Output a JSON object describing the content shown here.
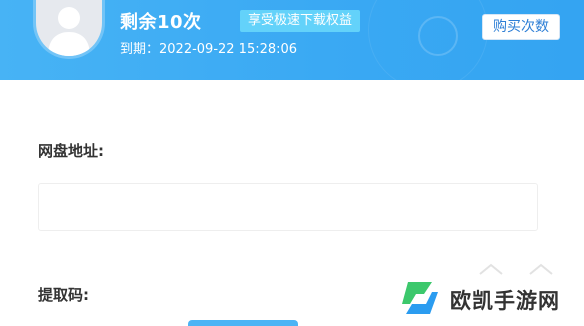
{
  "header": {
    "remaining": "剩余10次",
    "speed_badge": "享受极速下载权益",
    "expire": "到期：2022-09-22 15:28:06",
    "buy_button": "购买次数"
  },
  "form": {
    "url_label": "网盘地址:",
    "url_value": "",
    "url_placeholder": "",
    "code_label": "提取码:"
  },
  "watermark": {
    "text": "欧凯手游网"
  },
  "colors": {
    "header_blue": "#3aa9f3",
    "badge": "#63d2fa",
    "button_text": "#2e7fd6",
    "logo_green": "#3cc86c",
    "logo_blue": "#2b9cf0"
  },
  "icons": {
    "avatar": "user-silhouette-icon",
    "watermark_logo": "ok-logo-icon"
  }
}
